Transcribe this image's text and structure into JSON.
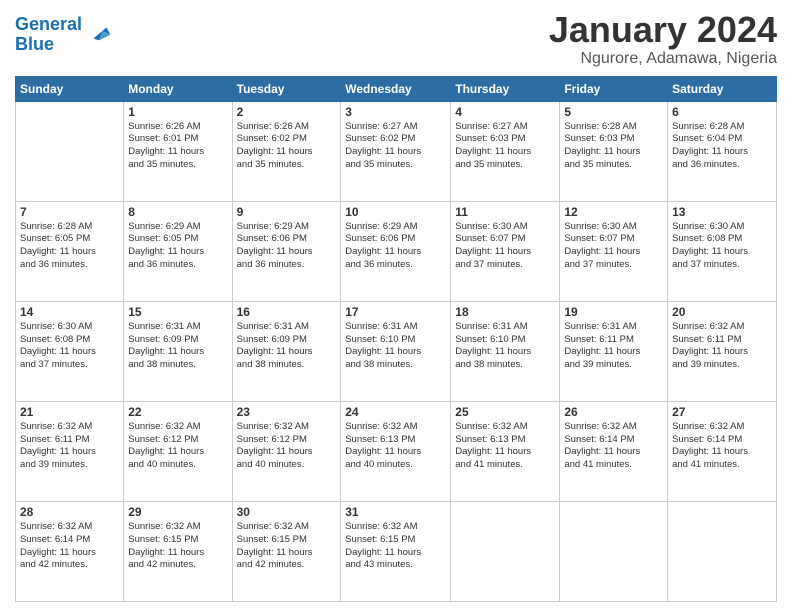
{
  "header": {
    "logo_line1": "General",
    "logo_line2": "Blue",
    "month_title": "January 2024",
    "location": "Ngurore, Adamawa, Nigeria"
  },
  "days_of_week": [
    "Sunday",
    "Monday",
    "Tuesday",
    "Wednesday",
    "Thursday",
    "Friday",
    "Saturday"
  ],
  "weeks": [
    [
      {
        "day": "",
        "sunrise": "",
        "sunset": "",
        "daylight": ""
      },
      {
        "day": "1",
        "sunrise": "Sunrise: 6:26 AM",
        "sunset": "Sunset: 6:01 PM",
        "daylight": "Daylight: 11 hours",
        "daylight2": "and 35 minutes."
      },
      {
        "day": "2",
        "sunrise": "Sunrise: 6:26 AM",
        "sunset": "Sunset: 6:02 PM",
        "daylight": "Daylight: 11 hours",
        "daylight2": "and 35 minutes."
      },
      {
        "day": "3",
        "sunrise": "Sunrise: 6:27 AM",
        "sunset": "Sunset: 6:02 PM",
        "daylight": "Daylight: 11 hours",
        "daylight2": "and 35 minutes."
      },
      {
        "day": "4",
        "sunrise": "Sunrise: 6:27 AM",
        "sunset": "Sunset: 6:03 PM",
        "daylight": "Daylight: 11 hours",
        "daylight2": "and 35 minutes."
      },
      {
        "day": "5",
        "sunrise": "Sunrise: 6:28 AM",
        "sunset": "Sunset: 6:03 PM",
        "daylight": "Daylight: 11 hours",
        "daylight2": "and 35 minutes."
      },
      {
        "day": "6",
        "sunrise": "Sunrise: 6:28 AM",
        "sunset": "Sunset: 6:04 PM",
        "daylight": "Daylight: 11 hours",
        "daylight2": "and 36 minutes."
      }
    ],
    [
      {
        "day": "7",
        "sunrise": "Sunrise: 6:28 AM",
        "sunset": "Sunset: 6:05 PM",
        "daylight": "Daylight: 11 hours",
        "daylight2": "and 36 minutes."
      },
      {
        "day": "8",
        "sunrise": "Sunrise: 6:29 AM",
        "sunset": "Sunset: 6:05 PM",
        "daylight": "Daylight: 11 hours",
        "daylight2": "and 36 minutes."
      },
      {
        "day": "9",
        "sunrise": "Sunrise: 6:29 AM",
        "sunset": "Sunset: 6:06 PM",
        "daylight": "Daylight: 11 hours",
        "daylight2": "and 36 minutes."
      },
      {
        "day": "10",
        "sunrise": "Sunrise: 6:29 AM",
        "sunset": "Sunset: 6:06 PM",
        "daylight": "Daylight: 11 hours",
        "daylight2": "and 36 minutes."
      },
      {
        "day": "11",
        "sunrise": "Sunrise: 6:30 AM",
        "sunset": "Sunset: 6:07 PM",
        "daylight": "Daylight: 11 hours",
        "daylight2": "and 37 minutes."
      },
      {
        "day": "12",
        "sunrise": "Sunrise: 6:30 AM",
        "sunset": "Sunset: 6:07 PM",
        "daylight": "Daylight: 11 hours",
        "daylight2": "and 37 minutes."
      },
      {
        "day": "13",
        "sunrise": "Sunrise: 6:30 AM",
        "sunset": "Sunset: 6:08 PM",
        "daylight": "Daylight: 11 hours",
        "daylight2": "and 37 minutes."
      }
    ],
    [
      {
        "day": "14",
        "sunrise": "Sunrise: 6:30 AM",
        "sunset": "Sunset: 6:08 PM",
        "daylight": "Daylight: 11 hours",
        "daylight2": "and 37 minutes."
      },
      {
        "day": "15",
        "sunrise": "Sunrise: 6:31 AM",
        "sunset": "Sunset: 6:09 PM",
        "daylight": "Daylight: 11 hours",
        "daylight2": "and 38 minutes."
      },
      {
        "day": "16",
        "sunrise": "Sunrise: 6:31 AM",
        "sunset": "Sunset: 6:09 PM",
        "daylight": "Daylight: 11 hours",
        "daylight2": "and 38 minutes."
      },
      {
        "day": "17",
        "sunrise": "Sunrise: 6:31 AM",
        "sunset": "Sunset: 6:10 PM",
        "daylight": "Daylight: 11 hours",
        "daylight2": "and 38 minutes."
      },
      {
        "day": "18",
        "sunrise": "Sunrise: 6:31 AM",
        "sunset": "Sunset: 6:10 PM",
        "daylight": "Daylight: 11 hours",
        "daylight2": "and 38 minutes."
      },
      {
        "day": "19",
        "sunrise": "Sunrise: 6:31 AM",
        "sunset": "Sunset: 6:11 PM",
        "daylight": "Daylight: 11 hours",
        "daylight2": "and 39 minutes."
      },
      {
        "day": "20",
        "sunrise": "Sunrise: 6:32 AM",
        "sunset": "Sunset: 6:11 PM",
        "daylight": "Daylight: 11 hours",
        "daylight2": "and 39 minutes."
      }
    ],
    [
      {
        "day": "21",
        "sunrise": "Sunrise: 6:32 AM",
        "sunset": "Sunset: 6:11 PM",
        "daylight": "Daylight: 11 hours",
        "daylight2": "and 39 minutes."
      },
      {
        "day": "22",
        "sunrise": "Sunrise: 6:32 AM",
        "sunset": "Sunset: 6:12 PM",
        "daylight": "Daylight: 11 hours",
        "daylight2": "and 40 minutes."
      },
      {
        "day": "23",
        "sunrise": "Sunrise: 6:32 AM",
        "sunset": "Sunset: 6:12 PM",
        "daylight": "Daylight: 11 hours",
        "daylight2": "and 40 minutes."
      },
      {
        "day": "24",
        "sunrise": "Sunrise: 6:32 AM",
        "sunset": "Sunset: 6:13 PM",
        "daylight": "Daylight: 11 hours",
        "daylight2": "and 40 minutes."
      },
      {
        "day": "25",
        "sunrise": "Sunrise: 6:32 AM",
        "sunset": "Sunset: 6:13 PM",
        "daylight": "Daylight: 11 hours",
        "daylight2": "and 41 minutes."
      },
      {
        "day": "26",
        "sunrise": "Sunrise: 6:32 AM",
        "sunset": "Sunset: 6:14 PM",
        "daylight": "Daylight: 11 hours",
        "daylight2": "and 41 minutes."
      },
      {
        "day": "27",
        "sunrise": "Sunrise: 6:32 AM",
        "sunset": "Sunset: 6:14 PM",
        "daylight": "Daylight: 11 hours",
        "daylight2": "and 41 minutes."
      }
    ],
    [
      {
        "day": "28",
        "sunrise": "Sunrise: 6:32 AM",
        "sunset": "Sunset: 6:14 PM",
        "daylight": "Daylight: 11 hours",
        "daylight2": "and 42 minutes."
      },
      {
        "day": "29",
        "sunrise": "Sunrise: 6:32 AM",
        "sunset": "Sunset: 6:15 PM",
        "daylight": "Daylight: 11 hours",
        "daylight2": "and 42 minutes."
      },
      {
        "day": "30",
        "sunrise": "Sunrise: 6:32 AM",
        "sunset": "Sunset: 6:15 PM",
        "daylight": "Daylight: 11 hours",
        "daylight2": "and 42 minutes."
      },
      {
        "day": "31",
        "sunrise": "Sunrise: 6:32 AM",
        "sunset": "Sunset: 6:15 PM",
        "daylight": "Daylight: 11 hours",
        "daylight2": "and 43 minutes."
      },
      {
        "day": "",
        "sunrise": "",
        "sunset": "",
        "daylight": "",
        "daylight2": ""
      },
      {
        "day": "",
        "sunrise": "",
        "sunset": "",
        "daylight": "",
        "daylight2": ""
      },
      {
        "day": "",
        "sunrise": "",
        "sunset": "",
        "daylight": "",
        "daylight2": ""
      }
    ]
  ]
}
